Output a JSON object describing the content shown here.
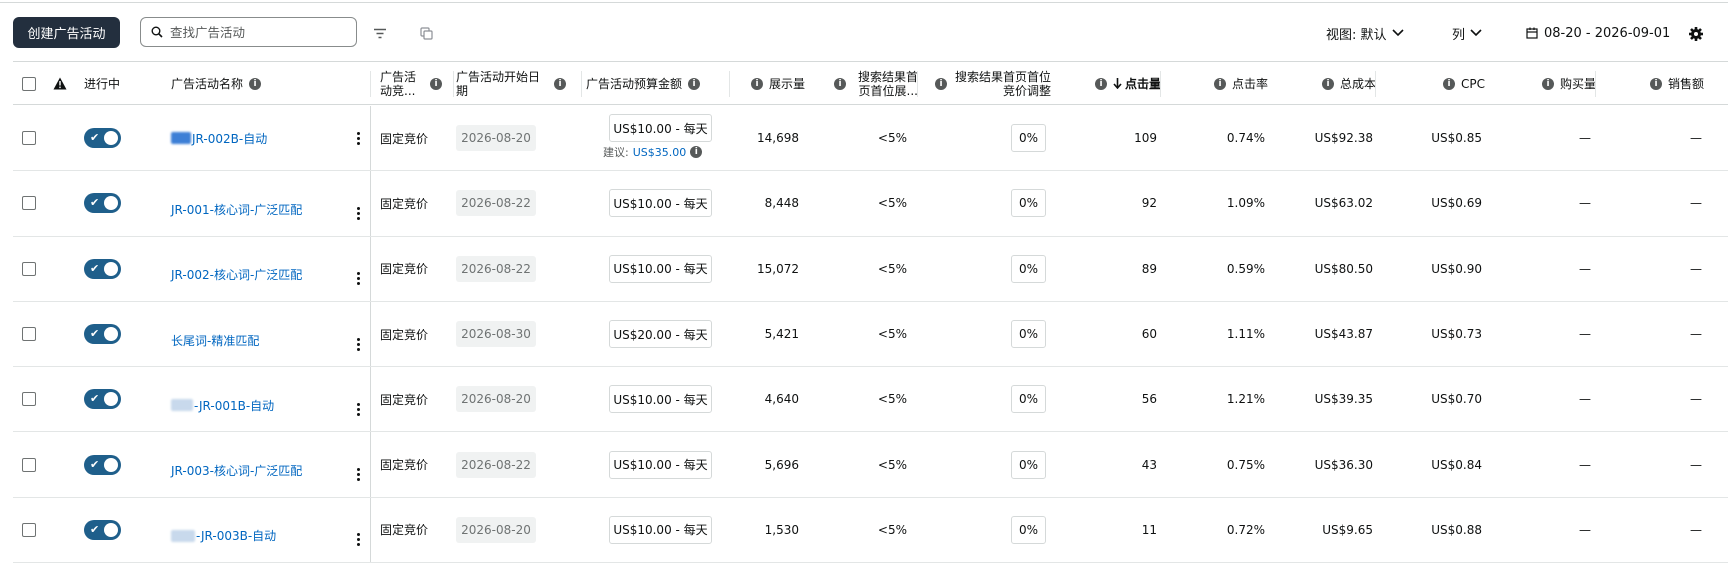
{
  "toolbar": {
    "create_label": "创建广告活动",
    "search_placeholder": "查找广告活动",
    "view_label": "视图: 默认",
    "columns_label": "列",
    "date_range": "08-20 - 2026-09-01"
  },
  "table": {
    "headers": {
      "active": "进行中",
      "name": "广告活动名称",
      "bidding": "广告活动竞...",
      "start_date": "广告活动开始日期",
      "budget": "广告活动预算金额",
      "impressions": "展示量",
      "top_share": "搜索结果首页首位展...",
      "top_adjust": "搜索结果首页首位竞价调整",
      "clicks": "点击量",
      "ctr": "点击率",
      "cost": "总成本",
      "cpc": "CPC",
      "purchases": "购买量",
      "sales": "销售额"
    },
    "suggestion_label": "建议:",
    "suggestion_amount": "US$35.00",
    "rows": [
      {
        "name": "JR-002B-自动",
        "bidding": "固定竞价",
        "start_date": "2026-08-20",
        "budget": "US$10.00 - 每天",
        "impressions": "14,698",
        "top_share": "<5%",
        "top_adjust": "0%",
        "clicks": "109",
        "ctr": "0.74%",
        "cost": "US$92.38",
        "cpc": "US$0.85",
        "purchases": "—",
        "sales": "—"
      },
      {
        "name": "JR-001-核心词-广泛匹配",
        "bidding": "固定竞价",
        "start_date": "2026-08-22",
        "budget": "US$10.00 - 每天",
        "impressions": "8,448",
        "top_share": "<5%",
        "top_adjust": "0%",
        "clicks": "92",
        "ctr": "1.09%",
        "cost": "US$63.02",
        "cpc": "US$0.69",
        "purchases": "—",
        "sales": "—"
      },
      {
        "name": "JR-002-核心词-广泛匹配",
        "bidding": "固定竞价",
        "start_date": "2026-08-22",
        "budget": "US$10.00 - 每天",
        "impressions": "15,072",
        "top_share": "<5%",
        "top_adjust": "0%",
        "clicks": "89",
        "ctr": "0.59%",
        "cost": "US$80.50",
        "cpc": "US$0.90",
        "purchases": "—",
        "sales": "—"
      },
      {
        "name": "长尾词-精准匹配",
        "bidding": "固定竞价",
        "start_date": "2026-08-30",
        "budget": "US$20.00 - 每天",
        "impressions": "5,421",
        "top_share": "<5%",
        "top_adjust": "0%",
        "clicks": "60",
        "ctr": "1.11%",
        "cost": "US$43.87",
        "cpc": "US$0.73",
        "purchases": "—",
        "sales": "—"
      },
      {
        "name": "-JR-001B-自动",
        "bidding": "固定竞价",
        "start_date": "2026-08-20",
        "budget": "US$10.00 - 每天",
        "impressions": "4,640",
        "top_share": "<5%",
        "top_adjust": "0%",
        "clicks": "56",
        "ctr": "1.21%",
        "cost": "US$39.35",
        "cpc": "US$0.70",
        "purchases": "—",
        "sales": "—"
      },
      {
        "name": "JR-003-核心词-广泛匹配",
        "bidding": "固定竞价",
        "start_date": "2026-08-22",
        "budget": "US$10.00 - 每天",
        "impressions": "5,696",
        "top_share": "<5%",
        "top_adjust": "0%",
        "clicks": "43",
        "ctr": "0.75%",
        "cost": "US$36.30",
        "cpc": "US$0.84",
        "purchases": "—",
        "sales": "—"
      },
      {
        "name": "-JR-003B-自动",
        "bidding": "固定竞价",
        "start_date": "2026-08-20",
        "budget": "US$10.00 - 每天",
        "impressions": "1,530",
        "top_share": "<5%",
        "top_adjust": "0%",
        "clicks": "11",
        "ctr": "0.72%",
        "cost": "US$9.65",
        "cpc": "US$0.88",
        "purchases": "—",
        "sales": "—"
      }
    ]
  },
  "colors": {
    "primary_button": "#232f3e",
    "toggle_on": "#1f5f8b",
    "link": "#0066c0"
  },
  "icons": [
    "search-icon",
    "filter-icon",
    "copy-icon",
    "chevron-down-icon",
    "calendar-icon",
    "gear-icon",
    "warning-icon",
    "info-icon",
    "arrow-down-icon",
    "more-vertical-icon"
  ]
}
